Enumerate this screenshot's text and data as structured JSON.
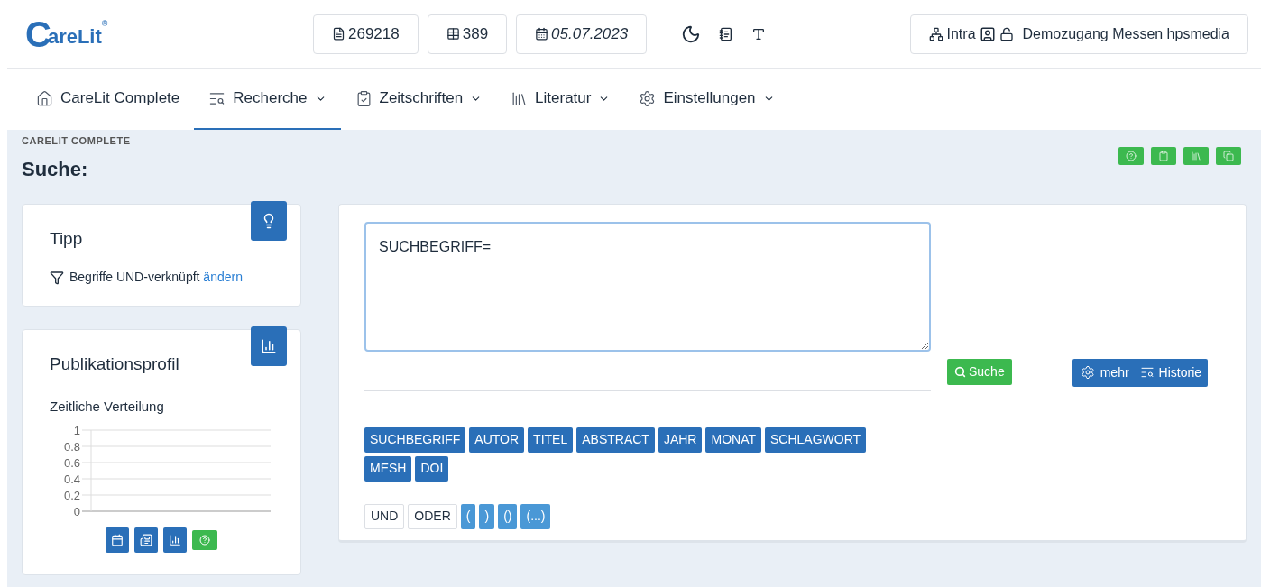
{
  "logo": {
    "initial": "C",
    "rest": "areLit",
    "registered": "®"
  },
  "counters": [
    {
      "kind": "pdf",
      "text": "269218"
    },
    {
      "kind": "table",
      "text": "389"
    },
    {
      "kind": "date",
      "text": "05.07.2023"
    }
  ],
  "user": {
    "network": "Intra",
    "name": "Demozugang Messen hpsmedia"
  },
  "nav": [
    {
      "label": "CareLit Complete",
      "dropdown": false,
      "selected": false
    },
    {
      "label": "Recherche",
      "dropdown": true,
      "selected": true
    },
    {
      "label": "Zeitschriften",
      "dropdown": true,
      "selected": false
    },
    {
      "label": "Literatur",
      "dropdown": true,
      "selected": false
    },
    {
      "label": "Einstellungen",
      "dropdown": true,
      "selected": false
    }
  ],
  "breadcrumb": "CARELIT COMPLETE",
  "title": "Suche:",
  "tip": {
    "title": "Tipp",
    "text": "Begriffe UND-verknüpft",
    "link": "ändern"
  },
  "profile": {
    "title": "Publikationsprofil",
    "chart_title": "Zeitliche Verteilung",
    "axis_labels": [
      "1",
      "0.8",
      "0.6",
      "0.4",
      "0.2",
      "0"
    ]
  },
  "search": {
    "value": "SUCHBEGRIFF=",
    "submit": "Suche",
    "more": "mehr",
    "history": "Historie"
  },
  "fields": [
    "SUCHBEGRIFF",
    "AUTOR",
    "TITEL",
    "ABSTRACT",
    "JAHR",
    "MONAT",
    "SCHLAGWORT",
    "MESH",
    "DOI"
  ],
  "operators": [
    {
      "kind": "logic",
      "text": "UND"
    },
    {
      "kind": "logic",
      "text": "ODER"
    },
    {
      "kind": "bracket",
      "text": "("
    },
    {
      "kind": "bracket",
      "text": ")"
    },
    {
      "kind": "bracket",
      "text": "()"
    },
    {
      "kind": "bracket",
      "text": "(...)"
    }
  ]
}
